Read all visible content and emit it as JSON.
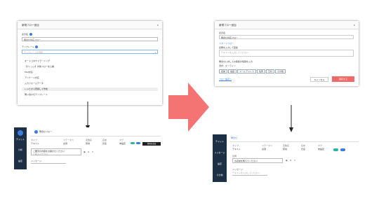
{
  "panel1": {
    "title": "新規フロー追加",
    "field1_label": "表示名",
    "field1_value": "問合せ対応フロー",
    "field2_label": "テンプレート",
    "field2_placeholder": "テンプレートを選択",
    "options": [
      "オートコネクトラーニング",
      "【ナレッジ】対象フローを公開",
      "FAQ対応",
      "アンケート対応",
      "入力フォームデータ",
      "レシピから登録して作成",
      "問い合わせテンプレート"
    ],
    "selected_index": 5
  },
  "panel2": {
    "title": "新規フロー追加",
    "name_label": "表示名",
    "name_value": "問合せ対応フロー",
    "section_title": "スタートフロー",
    "q1_text": "質問を入力して回答",
    "q1_placeholder": "テキストを入力してください",
    "q2_text": "問合せに対してお客様の情報を入力",
    "q2_value": "選択：オンライン",
    "chips": [
      "名前",
      "電話",
      "メールアドレス",
      "住所",
      "日付",
      "その他"
    ],
    "link": "フロー設定へ",
    "cancel_label": "キャンセル",
    "submit_label": "保存する",
    "accent": "#f06a6a"
  },
  "panel3": {
    "app_name": "問合せフロー",
    "sidebar": [
      "チャット",
      "分析",
      "設定"
    ],
    "col_labels": [
      "タイプ",
      "ステータス",
      "変数名",
      "名前",
      "タグ"
    ],
    "row_values": [
      "テキスト",
      "必須",
      "有効",
      "氏名",
      "未設定"
    ],
    "question": "ご要望の内容をお聞かせください",
    "question_sub": "ご記入ください",
    "add_button": "質問を追加",
    "footer_label": "メッセージ"
  },
  "panel4": {
    "app_name": "問合せ",
    "sidebar": [
      "チャット",
      "メッセージ",
      "設定",
      "その他"
    ],
    "col_labels": [
      "タイプ",
      "ステータス",
      "変数名",
      "名前",
      "タグ"
    ],
    "row_values": [
      "テキスト",
      "必須",
      "有効",
      "氏名",
      "未設定"
    ],
    "question_label": "質問",
    "question": "お名前を教えてください",
    "footer_label": "メッセージ",
    "footer_value": "テキストを入力してください"
  },
  "colors": {
    "arrow": "#f47474",
    "sidebar": "#1d2f45",
    "toggle": "#2bb3a3",
    "blue": "#3b7ddd"
  }
}
